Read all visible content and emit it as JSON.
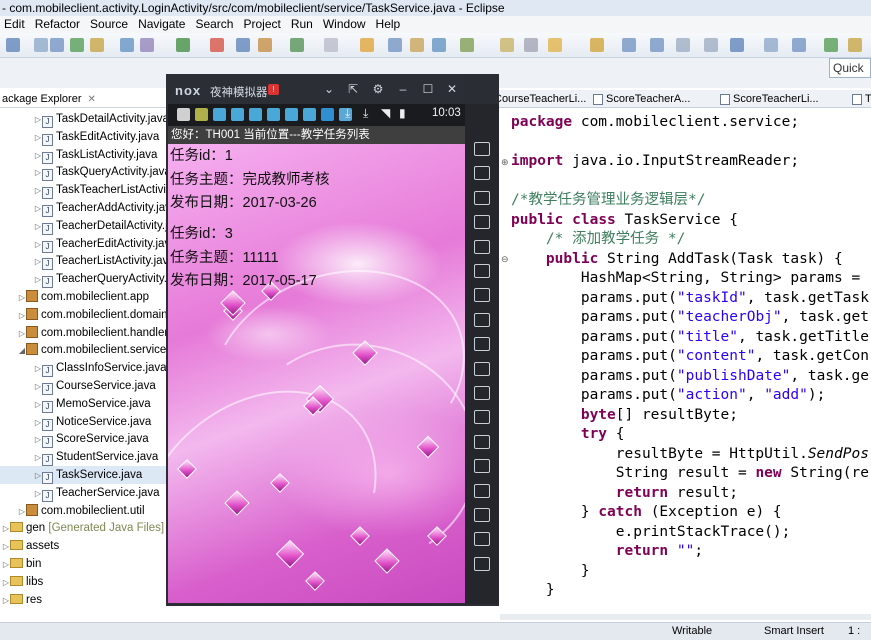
{
  "window": {
    "title": "- com.mobileclient.activity.LoginActivity/src/com/mobileclient/service/TaskService.java - Eclipse"
  },
  "menu": [
    "Edit",
    "Refactor",
    "Source",
    "Navigate",
    "Search",
    "Project",
    "Run",
    "Window",
    "Help"
  ],
  "quick_access": {
    "label": "Quick"
  },
  "package_explorer": {
    "tab_label": "ackage Explorer",
    "rows": [
      {
        "label": "TaskDetailActivity.java",
        "kind": "java",
        "indent": 34
      },
      {
        "label": "TaskEditActivity.java",
        "kind": "java",
        "indent": 34
      },
      {
        "label": "TaskListActivity.java",
        "kind": "java",
        "indent": 34
      },
      {
        "label": "TaskQueryActivity.java",
        "kind": "java",
        "indent": 34
      },
      {
        "label": "TaskTeacherListActivity.java",
        "kind": "java",
        "indent": 34
      },
      {
        "label": "TeacherAddActivity.java",
        "kind": "java",
        "indent": 34
      },
      {
        "label": "TeacherDetailActivity.java",
        "kind": "java",
        "indent": 34
      },
      {
        "label": "TeacherEditActivity.java",
        "kind": "java",
        "indent": 34
      },
      {
        "label": "TeacherListActivity.java",
        "kind": "java",
        "indent": 34
      },
      {
        "label": "TeacherQueryActivity.java",
        "kind": "java",
        "indent": 34
      },
      {
        "label": "com.mobileclient.app",
        "kind": "pkg",
        "indent": 18
      },
      {
        "label": "com.mobileclient.domain",
        "kind": "pkg",
        "indent": 18
      },
      {
        "label": "com.mobileclient.handler",
        "kind": "pkg",
        "indent": 18
      },
      {
        "label": "com.mobileclient.service",
        "kind": "pkg",
        "indent": 18
      },
      {
        "label": "ClassInfoService.java",
        "kind": "java",
        "indent": 34
      },
      {
        "label": "CourseService.java",
        "kind": "java",
        "indent": 34
      },
      {
        "label": "MemoService.java",
        "kind": "java",
        "indent": 34
      },
      {
        "label": "NoticeService.java",
        "kind": "java",
        "indent": 34
      },
      {
        "label": "ScoreService.java",
        "kind": "java",
        "indent": 34
      },
      {
        "label": "StudentService.java",
        "kind": "java",
        "indent": 34
      },
      {
        "label": "TaskService.java",
        "kind": "java",
        "indent": 34
      },
      {
        "label": "TeacherService.java",
        "kind": "java",
        "indent": 34
      },
      {
        "label": "com.mobileclient.util",
        "kind": "pkg",
        "indent": 18
      },
      {
        "label": "gen",
        "extra": "[Generated Java Files]",
        "kind": "folder",
        "indent": 2
      },
      {
        "label": "assets",
        "kind": "folder",
        "indent": 2
      },
      {
        "label": "bin",
        "kind": "folder",
        "indent": 2
      },
      {
        "label": "libs",
        "kind": "folder",
        "indent": 2
      },
      {
        "label": "res",
        "kind": "folder",
        "indent": 2
      }
    ]
  },
  "editor": {
    "tabs": [
      "CourseTeacherLi...",
      "ScoreTeacherA...",
      "ScoreTeacherLi...",
      "T"
    ],
    "lines": [
      [
        {
          "t": "package",
          "c": "kw"
        },
        {
          "t": " com.mobileclient.service;"
        }
      ],
      [],
      [
        {
          "t": "import",
          "c": "kw"
        },
        {
          "t": " java.io.InputStreamReader;"
        }
      ],
      [],
      [
        {
          "t": "/*教学任务管理业务逻辑层*/",
          "c": "cm"
        }
      ],
      [
        {
          "t": "public",
          "c": "kw"
        },
        {
          "t": " "
        },
        {
          "t": "class",
          "c": "kw"
        },
        {
          "t": " TaskService {"
        }
      ],
      [
        {
          "t": "    /* 添加教学任务 */",
          "c": "cm"
        }
      ],
      [
        {
          "t": "    "
        },
        {
          "t": "public",
          "c": "kw"
        },
        {
          "t": " String AddTask(Task task) {"
        }
      ],
      [
        {
          "t": "        HashMap<String, String> params = "
        }
      ],
      [
        {
          "t": "        params.put("
        },
        {
          "t": "\"taskId\"",
          "c": "str"
        },
        {
          "t": ", task.getTask"
        }
      ],
      [
        {
          "t": "        params.put("
        },
        {
          "t": "\"teacherObj\"",
          "c": "str"
        },
        {
          "t": ", task.get"
        }
      ],
      [
        {
          "t": "        params.put("
        },
        {
          "t": "\"title\"",
          "c": "str"
        },
        {
          "t": ", task.getTitle"
        }
      ],
      [
        {
          "t": "        params.put("
        },
        {
          "t": "\"content\"",
          "c": "str"
        },
        {
          "t": ", task.getCon"
        }
      ],
      [
        {
          "t": "        params.put("
        },
        {
          "t": "\"publishDate\"",
          "c": "str"
        },
        {
          "t": ", task.ge"
        }
      ],
      [
        {
          "t": "        params.put("
        },
        {
          "t": "\"action\"",
          "c": "str"
        },
        {
          "t": ", "
        },
        {
          "t": "\"add\"",
          "c": "str"
        },
        {
          "t": ");"
        }
      ],
      [
        {
          "t": "        "
        },
        {
          "t": "byte",
          "c": "kw"
        },
        {
          "t": "[] resultByte;"
        }
      ],
      [
        {
          "t": "        "
        },
        {
          "t": "try",
          "c": "kw"
        },
        {
          "t": " {"
        }
      ],
      [
        {
          "t": "            resultByte = HttpUtil."
        },
        {
          "t": "SendPos",
          "c": "it"
        }
      ],
      [
        {
          "t": "            String result = "
        },
        {
          "t": "new",
          "c": "kw"
        },
        {
          "t": " String(re"
        }
      ],
      [
        {
          "t": "            "
        },
        {
          "t": "return",
          "c": "kw"
        },
        {
          "t": " result;"
        }
      ],
      [
        {
          "t": "        } "
        },
        {
          "t": "catch",
          "c": "kw"
        },
        {
          "t": " (Exception e) {"
        }
      ],
      [
        {
          "t": "            e.printStackTrace();"
        }
      ],
      [
        {
          "t": "            "
        },
        {
          "t": "return",
          "c": "kw"
        },
        {
          "t": " "
        },
        {
          "t": "\"\"",
          "c": "str"
        },
        {
          "t": ";"
        }
      ],
      [
        {
          "t": "        }"
        }
      ],
      [
        {
          "t": "    }"
        }
      ]
    ]
  },
  "status": {
    "writable": "Writable",
    "insert": "Smart Insert",
    "pos": "1 :"
  },
  "emulator": {
    "logo": "nox",
    "name": "夜神模拟器",
    "badge": "!",
    "clock": "10:03",
    "header": "您好：TH001  当前位置---教学任务列表",
    "tasks": [
      {
        "id": "任务id：1",
        "title": "任务主题：完成教师考核",
        "date": "发布日期：2017-03-26"
      },
      {
        "id": "任务id：3",
        "title": "任务主题：11111",
        "date": "发布日期：2017-05-17"
      }
    ]
  },
  "colors": {
    "keyword": "#7f0055",
    "string": "#2a00ff",
    "comment": "#3f7f5f"
  }
}
